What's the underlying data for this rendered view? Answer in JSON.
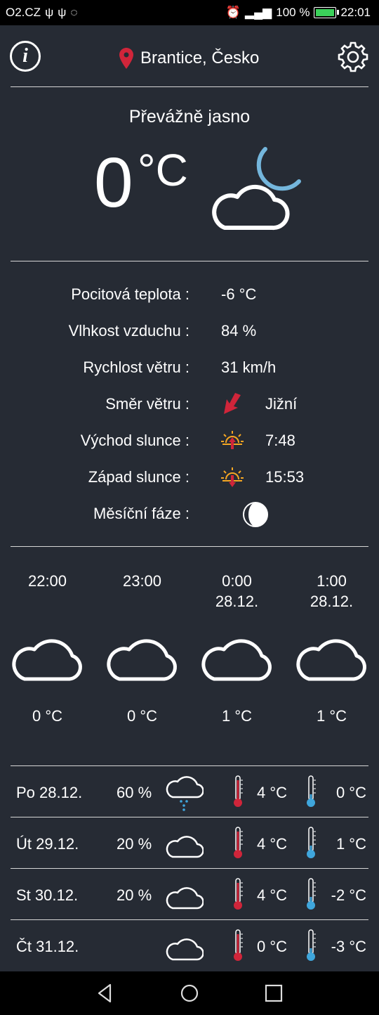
{
  "status_bar": {
    "carrier": "O2.CZ",
    "battery": "100 %",
    "battery_level": 1.0,
    "time": "22:01"
  },
  "header": {
    "info_label": "i",
    "location": "Brantice, Česko"
  },
  "current": {
    "condition": "Převážně jasno",
    "temperature": "0",
    "unit": "°C",
    "icon": "cloud-moon-icon"
  },
  "details": [
    {
      "label": "Pocitová teplota :",
      "value": "-6 °C"
    },
    {
      "label": "Vlhkost vzduchu :",
      "value": "84 %"
    },
    {
      "label": "Rychlost větru :",
      "value": "31 km/h"
    },
    {
      "label": "Směr větru :",
      "value": "Jižní",
      "icon": "wind-direction-arrow-icon"
    },
    {
      "label": "Východ slunce :",
      "value": "7:48",
      "icon": "sunrise-icon"
    },
    {
      "label": "Západ slunce :",
      "value": "15:53",
      "icon": "sunset-icon"
    },
    {
      "label": "Měsíční fáze :",
      "value": "",
      "icon": "moon-phase-icon"
    }
  ],
  "hourly": [
    {
      "time": "22:00",
      "date": "",
      "temp": "0 °C",
      "icon": "cloud-icon"
    },
    {
      "time": "23:00",
      "date": "",
      "temp": "0 °C",
      "icon": "cloud-icon"
    },
    {
      "time": "0:00",
      "date": "28.12.",
      "temp": "1 °C",
      "icon": "cloud-icon"
    },
    {
      "time": "1:00",
      "date": "28.12.",
      "temp": "1 °C",
      "icon": "cloud-icon"
    }
  ],
  "daily": [
    {
      "day": "Po 28.12.",
      "precip": "60 %",
      "icon": "cloud-snow-icon",
      "max": "4 °C",
      "min": "0 °C"
    },
    {
      "day": "Út 29.12.",
      "precip": "20 %",
      "icon": "cloud-icon",
      "max": "4 °C",
      "min": "1 °C"
    },
    {
      "day": "St 30.12.",
      "precip": "20 %",
      "icon": "cloud-icon",
      "max": "4 °C",
      "min": "-2 °C"
    },
    {
      "day": "Čt 31.12.",
      "precip": "",
      "icon": "cloud-icon",
      "max": "0 °C",
      "min": "-3 °C"
    }
  ],
  "colors": {
    "background": "#262b34",
    "accent_red": "#d0253a",
    "accent_blue": "#3fa6dc",
    "sun_orange": "#f5a623",
    "moon_blue": "#74b6dc"
  }
}
